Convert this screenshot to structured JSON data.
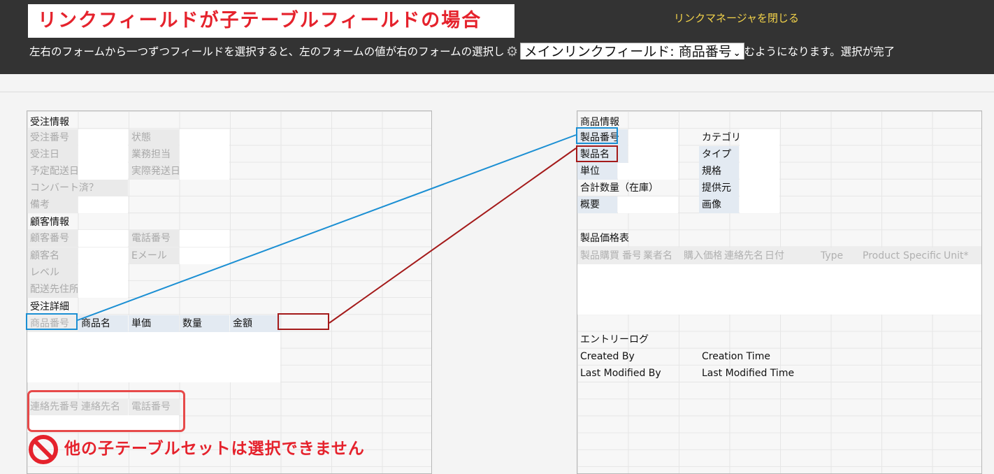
{
  "header": {
    "title": "リンクフィールドが子テーブルフィールドの場合",
    "close_link": "リンクマネージャを閉じる",
    "instruction_prefix": "左右のフォームから一つずつフィールドを選択すると、左のフォームの値が右のフォームの選択し",
    "select_value": "メインリンクフィールド: 商品番号",
    "instruction_suffix": "むようになります。選択が完了"
  },
  "colors": {
    "title_red": "#e5222c",
    "close_link_yellow": "#f2d24a",
    "topbar": "#333333",
    "link_blue": "#1b8fd3",
    "link_darkred": "#a41a1a",
    "warning_red": "#e74a4a"
  },
  "left_form": {
    "section_order": "受注情報",
    "order_number": "受注番号",
    "status": "状態",
    "order_date": "受注日",
    "assignee": "業務担当",
    "planned_ship": "予定配送日",
    "actual_ship": "実際発送日",
    "converted": "コンバート済？",
    "notes": "備考",
    "section_customer": "顧客情報",
    "customer_number": "顧客番号",
    "phone": "電話番号",
    "customer_name": "顧客名",
    "email": "Eメール",
    "level": "レベル",
    "ship_address": "配送先住所",
    "section_details": "受注詳細",
    "details_columns": [
      "商品番号",
      "商品名",
      "単価",
      "数量",
      "金額"
    ],
    "contact_columns": [
      "連絡先番号",
      "連絡先名",
      "電話番号"
    ]
  },
  "right_form": {
    "section_product": "商品情報",
    "product_number": "製品番号",
    "category": "カテゴリー",
    "product_name": "製品名",
    "type": "タイプ",
    "unit": "単位",
    "spec": "規格",
    "total_qty": "合計数量（在庫）",
    "supplier": "提供元",
    "summary": "概要",
    "image": "画像",
    "section_price": "製品価格表",
    "price_columns": [
      "製品購買番号",
      "番号",
      "業者名",
      "購入価格",
      "連絡先名",
      "日付",
      "Type",
      "Product",
      "Specific",
      "Unit*"
    ],
    "section_log": "エントリーログ",
    "created_by": "Created By",
    "creation_time": "Creation Time",
    "last_modified_by": "Last Modified By",
    "last_modified_time": "Last Modified Time"
  },
  "warning": {
    "text": "他の子テーブルセットは選択できません",
    "icon": "prohibited-icon"
  }
}
